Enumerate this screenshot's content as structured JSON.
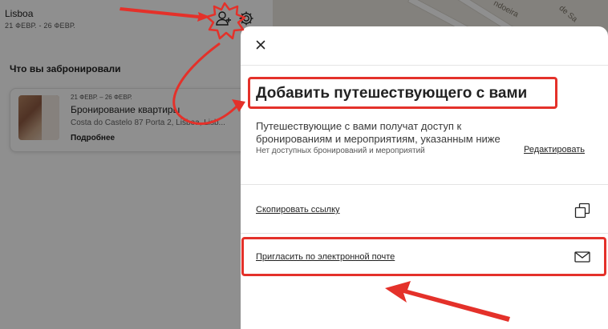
{
  "trip": {
    "city": "Lisboa",
    "dates": "21 ФЕВР. - 26 ФЕВР."
  },
  "map": {
    "street_label": "ndoeira",
    "street_label_2": "de Sa"
  },
  "booked_section": {
    "title": "Что вы забронировали",
    "card": {
      "dates": "21 ФЕВР. – 26 ФЕВР.",
      "name": "Бронирование квартиры",
      "address": "Costa do Castelo 87 Porta 2, Lisboa, Lisb...",
      "more_label": "Подробнее"
    }
  },
  "modal": {
    "close_icon": "close-icon",
    "title": "Добавить путешествующего с вами",
    "description": "Путешествующие с вами получат доступ к бронированиям и мероприятиям, указанным ниже",
    "no_bookings": "Нет доступных бронирований и мероприятий",
    "edit_label": "Редактировать",
    "copy_link_label": "Скопировать ссылку",
    "copy_icon": "copy-icon",
    "invite_email_label": "Пригласить по электронной почте",
    "email_icon": "envelope-icon"
  },
  "icons": {
    "add_person": "add-person-icon",
    "settings": "gear-icon"
  },
  "colors": {
    "annotation": "#e4312a",
    "overlay": "rgba(0,0,0,0.44)"
  }
}
